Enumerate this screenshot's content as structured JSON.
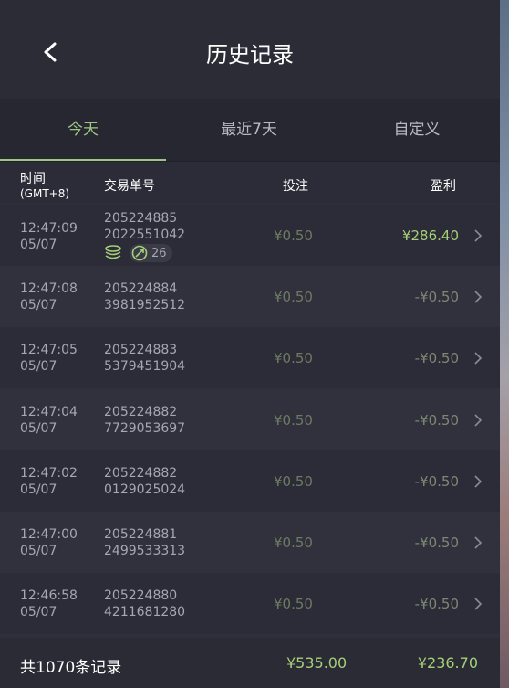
{
  "header": {
    "title": "历史记录"
  },
  "tabs": [
    {
      "label": "今天"
    },
    {
      "label": "最近7天"
    },
    {
      "label": "自定义"
    }
  ],
  "table": {
    "columns": {
      "time": "时间",
      "timezone": "(GMT+8)",
      "order": "交易单号",
      "bet": "投注",
      "profit": "盈利"
    },
    "rows": [
      {
        "time": "12:47:09",
        "date": "05/07",
        "order1": "205224885",
        "order2": "2022551042",
        "bet": "¥0.50",
        "profit": "¥286.40",
        "win": true,
        "free_spins": "26"
      },
      {
        "time": "12:47:08",
        "date": "05/07",
        "order1": "205224884",
        "order2": "3981952512",
        "bet": "¥0.50",
        "profit": "-¥0.50"
      },
      {
        "time": "12:47:05",
        "date": "05/07",
        "order1": "205224883",
        "order2": "5379451904",
        "bet": "¥0.50",
        "profit": "-¥0.50"
      },
      {
        "time": "12:47:04",
        "date": "05/07",
        "order1": "205224882",
        "order2": "7729053697",
        "bet": "¥0.50",
        "profit": "-¥0.50"
      },
      {
        "time": "12:47:02",
        "date": "05/07",
        "order1": "205224882",
        "order2": "0129025024",
        "bet": "¥0.50",
        "profit": "-¥0.50"
      },
      {
        "time": "12:47:00",
        "date": "05/07",
        "order1": "205224881",
        "order2": "2499533313",
        "bet": "¥0.50",
        "profit": "-¥0.50"
      },
      {
        "time": "12:46:58",
        "date": "05/07",
        "order1": "205224880",
        "order2": "4211681280",
        "bet": "¥0.50",
        "profit": "-¥0.50"
      }
    ]
  },
  "footer": {
    "count": "共1070条记录",
    "total_bet": "¥535.00",
    "total_profit": "¥236.70"
  },
  "colors": {
    "accent": "#9fc583",
    "win": "#a5cf78",
    "loss": "#7d8873",
    "background": "#2e2f3a"
  },
  "icons": {
    "back": "chevron-left-icon",
    "row_arrow": "chevron-right-icon",
    "coins": "coin-stack-icon",
    "free_spin": "swap-circle-icon"
  }
}
